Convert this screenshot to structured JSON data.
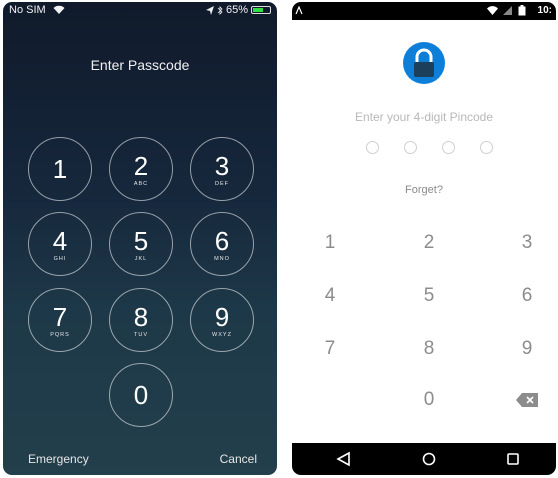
{
  "ios": {
    "status": {
      "carrier": "No SIM",
      "battery": "65%",
      "battery_fraction": 0.65
    },
    "title": "Enter Passcode",
    "keys": [
      {
        "num": "1",
        "letters": ""
      },
      {
        "num": "2",
        "letters": "ABC"
      },
      {
        "num": "3",
        "letters": "DEF"
      },
      {
        "num": "4",
        "letters": "GHI"
      },
      {
        "num": "5",
        "letters": "JKL"
      },
      {
        "num": "6",
        "letters": "MNO"
      },
      {
        "num": "7",
        "letters": "PQRS"
      },
      {
        "num": "8",
        "letters": "TUV"
      },
      {
        "num": "9",
        "letters": "WXYZ"
      },
      {
        "num": "0",
        "letters": ""
      }
    ],
    "emergency": "Emergency",
    "cancel": "Cancel"
  },
  "android": {
    "status": {
      "time": "10:"
    },
    "prompt": "Enter your 4-digit Pincode",
    "forgot": "Forget?",
    "keys": [
      "1",
      "2",
      "3",
      "4",
      "5",
      "6",
      "7",
      "8",
      "9",
      "0"
    ],
    "colors": {
      "accent": "#0e7fd8",
      "lock_body": "#1c3f5c"
    },
    "nav": [
      "back-icon",
      "home-icon",
      "recents-icon"
    ]
  }
}
